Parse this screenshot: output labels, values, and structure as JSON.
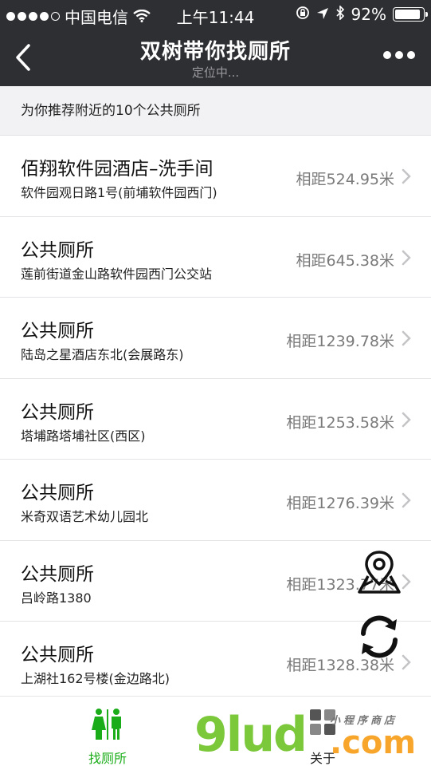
{
  "status_bar": {
    "carrier": "中国电信",
    "time": "上午11:44",
    "battery": "92%",
    "battery_level": 0.92
  },
  "nav": {
    "title": "双树带你找厕所",
    "subtitle": "定位中..."
  },
  "header_note": "为你推荐附近的10个公共厕所",
  "list": {
    "items": [
      {
        "name": "佰翔软件园酒店–洗手间",
        "address": "软件园观日路1号(前埔软件园西门)",
        "distance": "相距524.95米"
      },
      {
        "name": "公共厕所",
        "address": "莲前街道金山路软件园西门公交站",
        "distance": "相距645.38米"
      },
      {
        "name": "公共厕所",
        "address": "陆岛之星酒店东北(会展路东)",
        "distance": "相距1239.78米"
      },
      {
        "name": "公共厕所",
        "address": "塔埔路塔埔社区(西区)",
        "distance": "相距1253.58米"
      },
      {
        "name": "公共厕所",
        "address": "米奇双语艺术幼儿园北",
        "distance": "相距1276.39米"
      },
      {
        "name": "公共厕所",
        "address": "吕岭路1380",
        "distance": "相距1323.77米"
      },
      {
        "name": "公共厕所",
        "address": "上湖社162号楼(金边路北)",
        "distance": "相距1328.38米"
      }
    ]
  },
  "tabbar": {
    "tabs": [
      {
        "label": "找厕所",
        "icon": "restroom-icon",
        "active": true
      },
      {
        "label": "关于",
        "icon": "grid-icon",
        "active": false
      }
    ]
  },
  "watermark": {
    "brand": "9lud",
    "suffix": ".com",
    "tagline": "小程序商店"
  },
  "colors": {
    "nav_background": "#2e2f33",
    "active_tab": "#1aad19",
    "distance_text": "#7a7a7a"
  }
}
